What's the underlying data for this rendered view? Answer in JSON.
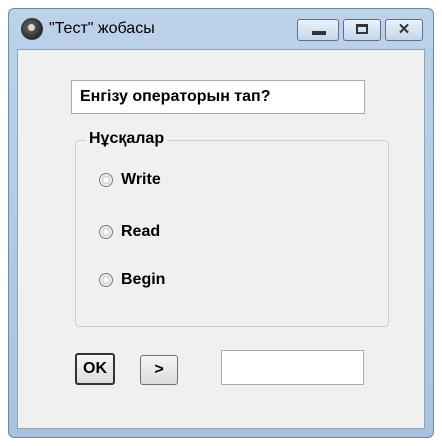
{
  "window": {
    "title": "\"Тест\" жобасы",
    "controls": {
      "minimize": "minimize",
      "maximize": "maximize",
      "close": "✕"
    }
  },
  "question": {
    "text": "Енгізу операторын тап?"
  },
  "options_group": {
    "label": "Нұсқалар",
    "options": [
      {
        "label": "Write",
        "selected": false
      },
      {
        "label": "Read",
        "selected": false
      },
      {
        "label": "Begin",
        "selected": false
      }
    ]
  },
  "buttons": {
    "ok": "OK",
    "next": ">"
  },
  "answer": {
    "value": ""
  },
  "colors": {
    "titlebar": "#bcd2ea",
    "client": "#f0f0f0",
    "frame": "#6f8aa6"
  }
}
